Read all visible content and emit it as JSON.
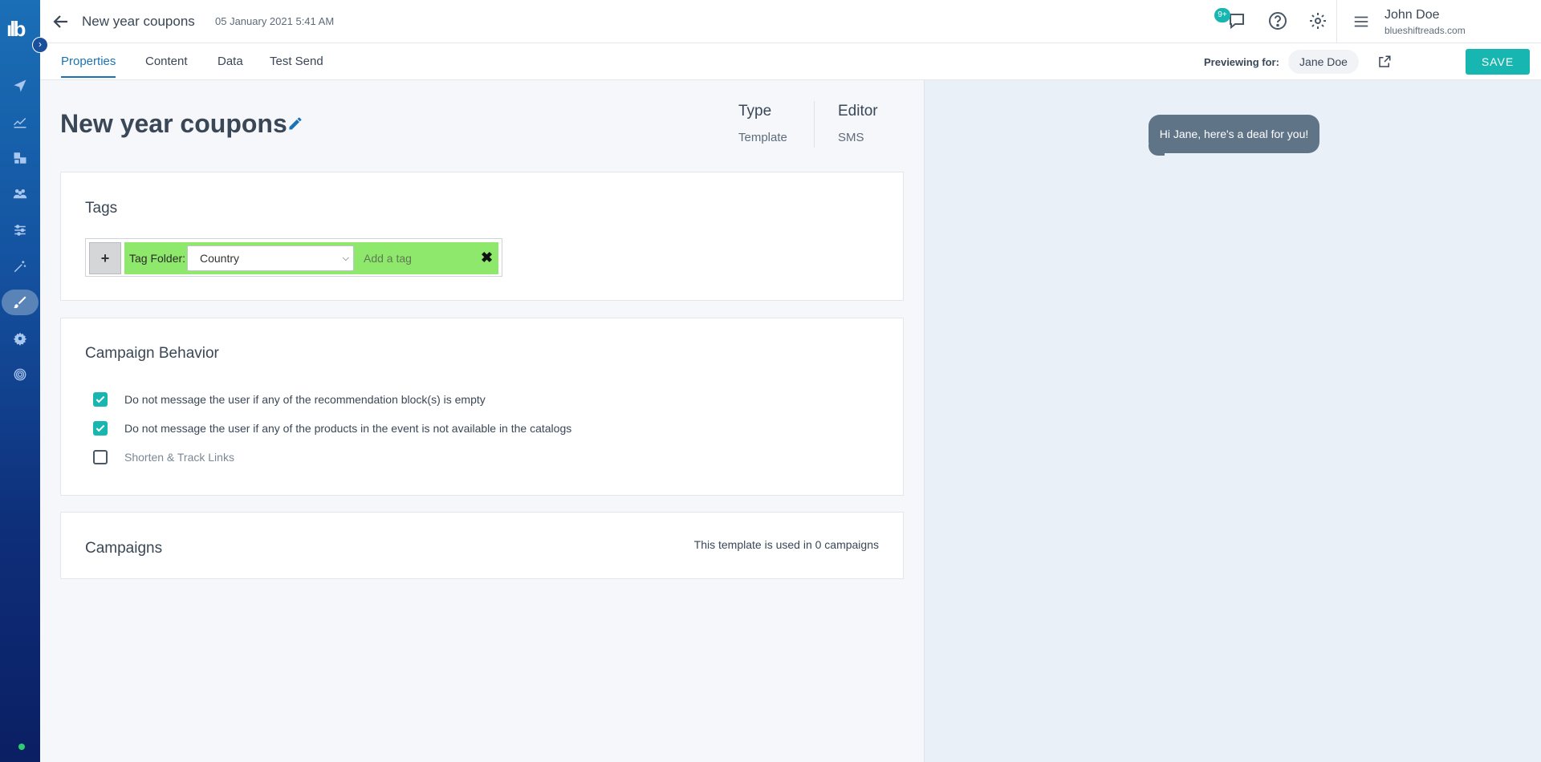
{
  "sidebar": {
    "logo": "ılb",
    "items": [
      {
        "icon": "send-icon"
      },
      {
        "icon": "analytics-icon"
      },
      {
        "icon": "content-icon"
      },
      {
        "icon": "people-icon"
      },
      {
        "icon": "sliders-icon"
      },
      {
        "icon": "magic-wand-icon"
      },
      {
        "icon": "brush-icon",
        "active": true
      },
      {
        "icon": "gear-cog-icon"
      },
      {
        "icon": "fingerprint-icon"
      }
    ]
  },
  "header": {
    "title": "New year coupons",
    "date": "05 January 2021 5:41 AM",
    "notifications_badge": "9+",
    "user_name": "John Doe",
    "user_org": "blueshiftreads.com"
  },
  "tabs": [
    {
      "label": "Properties",
      "active": true
    },
    {
      "label": "Content"
    },
    {
      "label": "Data"
    },
    {
      "label": "Test Send"
    }
  ],
  "preview_bar": {
    "label": "Previewing for:",
    "user": "Jane Doe",
    "save_label": "SAVE"
  },
  "page": {
    "title": "New year coupons",
    "type_key": "Type",
    "type_value": "Template",
    "editor_key": "Editor",
    "editor_value": "SMS"
  },
  "tags": {
    "heading": "Tags",
    "add_label": "+",
    "folder_label": "Tag Folder:",
    "folder_value": "Country",
    "input_placeholder": "Add a tag",
    "remove_label": "✖"
  },
  "behavior": {
    "heading": "Campaign Behavior",
    "options": [
      {
        "label": "Do not message the user if any of the recommendation block(s) is empty",
        "checked": true
      },
      {
        "label": "Do not message the user if any of the products in the event is not available in the catalogs",
        "checked": true
      },
      {
        "label": "Shorten & Track Links",
        "checked": false
      }
    ]
  },
  "campaigns": {
    "heading": "Campaigns",
    "note": "This template is used in 0 campaigns"
  },
  "preview": {
    "message": "Hi Jane, here's a deal for you!"
  },
  "colors": {
    "accent": "#17b6b0",
    "link": "#1a73b5",
    "tag_green": "#8ee86b",
    "bubble": "#607487"
  }
}
